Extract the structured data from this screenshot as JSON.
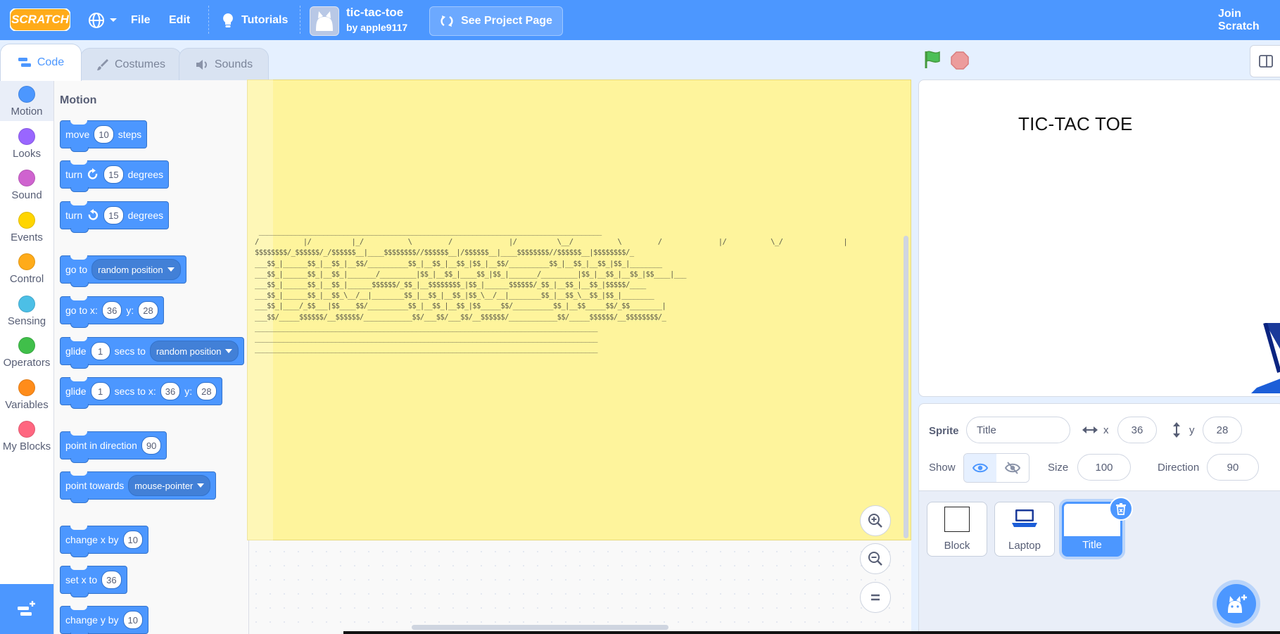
{
  "menu": {
    "logo": "SCRATCH",
    "file": "File",
    "edit": "Edit",
    "tutorials": "Tutorials",
    "project_title": "tic-tac-toe",
    "project_author": "by apple9117",
    "see_project_page": "See Project Page",
    "join": "Join Scratch"
  },
  "tabs": {
    "code": "Code",
    "costumes": "Costumes",
    "sounds": "Sounds"
  },
  "categories": [
    {
      "label": "Motion",
      "color": "#4c97ff"
    },
    {
      "label": "Looks",
      "color": "#9966ff"
    },
    {
      "label": "Sound",
      "color": "#cf63cf"
    },
    {
      "label": "Events",
      "color": "#ffd500"
    },
    {
      "label": "Control",
      "color": "#ffab19"
    },
    {
      "label": "Sensing",
      "color": "#4cbfe6"
    },
    {
      "label": "Operators",
      "color": "#40bf4a"
    },
    {
      "label": "Variables",
      "color": "#ff8c1a"
    },
    {
      "label": "My Blocks",
      "color": "#ff6680"
    }
  ],
  "palette": {
    "title": "Motion",
    "move": {
      "a": "move",
      "v": "10",
      "b": "steps"
    },
    "turn_right": {
      "a": "turn",
      "v": "15",
      "b": "degrees"
    },
    "turn_left": {
      "a": "turn",
      "v": "15",
      "b": "degrees"
    },
    "goto": {
      "a": "go to",
      "opt": "random position"
    },
    "gotoxy": {
      "a": "go to x:",
      "x": "36",
      "b": "y:",
      "y": "28"
    },
    "glide_to": {
      "a": "glide",
      "v": "1",
      "b": "secs to",
      "opt": "random position"
    },
    "glide_xy": {
      "a": "glide",
      "v": "1",
      "b": "secs to x:",
      "x": "36",
      "c": "y:",
      "y": "28"
    },
    "point_dir": {
      "a": "point in direction",
      "v": "90"
    },
    "point_towards": {
      "a": "point towards",
      "opt": "mouse-pointer"
    },
    "change_x": {
      "a": "change x by",
      "v": "10"
    },
    "set_x": {
      "a": "set x to",
      "v": "36"
    },
    "change_y": {
      "a": "change y by",
      "v": "10"
    }
  },
  "comment": {
    "ascii": " _____________________________________________________________________________________\n/           |/          |_/           \\         /              |/          \\__/           \\         /              |/           \\_/               |\n$$$$$$$$/_$$$$$$/_/$$$$$$__|____$$$$$$$$//$$$$$$__|/$$$$$$__|____$$$$$$$$//$$$$$$__|$$$$$$$$/_\n___$$_|______$$_|__$$_|__$$/__________$$_|__$$_|__$$_|$$_|__$$/__________$$_|__$$_|__$$_|$$_|________\n___$$_|______$$_|__$$_|_______/_________|$$_|__$$_|____$$_|$$_|_______/_________|$$_|__$$_|__$$_|$$____|___\n___$$_|______$$_|__$$_|______$$$$$$/_$$_|__$$$$$$$$_|$$_|______$$$$$$/_$$_|__$$_|__$$_|$$$$$/____\n___$$_|______$$_|__$$_\\__/__|________$$_|__$$_|__$$_|$$_\\__/__|________$$_|__$$_\\__$$_|$$_|________\n___$$_|____/_$$___|$$____$$/__________$$_|__$$_|__$$_|$$_____$$/__________$$_|__$$_____$$/_$$________|\n___$$/_____$$$$$$/__$$$$$$/____________$$/___$$/___$$/__$$$$$$/____________$$/_____$$$$$$/__$$$$$$$$/_\n_____________________________________________________________________________________\n_____________________________________________________________________________________\n_____________________________________________________________________________________"
  },
  "stage": {
    "title_text": "TIC-TAC TOE"
  },
  "sprite_info": {
    "sprite_label": "Sprite",
    "name": "Title",
    "x_label": "x",
    "x": "36",
    "y_label": "y",
    "y": "28",
    "show_label": "Show",
    "size_label": "Size",
    "size": "100",
    "direction_label": "Direction",
    "direction": "90"
  },
  "sprites": [
    {
      "name": "Block"
    },
    {
      "name": "Laptop"
    },
    {
      "name": "Title",
      "selected": true
    }
  ]
}
